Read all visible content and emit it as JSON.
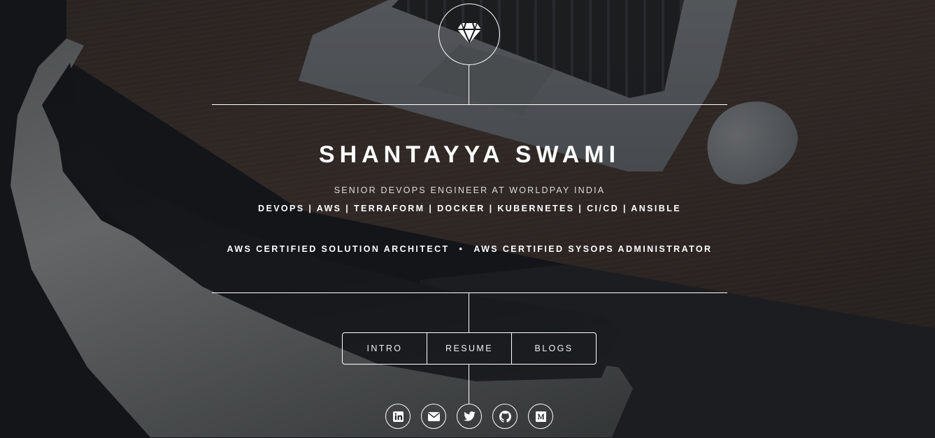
{
  "header": {
    "logo_icon": "diamond-icon",
    "name": "SHANTAYYA SWAMI",
    "subtitle": "SENIOR DEVOPS ENGINEER AT WORLDPAY INDIA",
    "skills": "DEVOPS | AWS | TERRAFORM | DOCKER | KUBERNETES | CI/CD | ANSIBLE",
    "certifications": [
      "AWS CERTIFIED SOLUTION ARCHITECT",
      "AWS CERTIFIED SYSOPS ADMINISTRATOR"
    ],
    "cert_separator": "•"
  },
  "nav": {
    "items": [
      {
        "label": "INTRO"
      },
      {
        "label": "RESUME"
      },
      {
        "label": "BLOGS"
      }
    ]
  },
  "social": {
    "icons": [
      "linkedin-icon",
      "envelope-icon",
      "twitter-icon",
      "github-icon",
      "medium-icon"
    ]
  },
  "colors": {
    "foreground": "#ffffff",
    "overlay": "#101216"
  }
}
